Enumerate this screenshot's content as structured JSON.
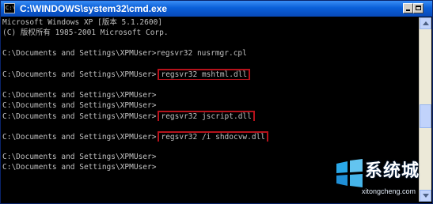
{
  "window": {
    "title": "C:\\WINDOWS\\system32\\cmd.exe",
    "icon_name": "cmd-icon",
    "icon_text": "C:\\",
    "buttons": [
      "minimize-icon",
      "maximize-icon"
    ]
  },
  "console": {
    "lines": [
      {
        "text": "Microsoft Windows XP [版本 5.1.2600]"
      },
      {
        "text": "(C) 版权所有 1985-2001 Microsoft Corp."
      },
      {
        "text": ""
      },
      {
        "text": "C:\\Documents and Settings\\XPMUser>regsvr32 nusrmgr.cpl"
      },
      {
        "text": ""
      },
      {
        "text": "C:\\Documents and Settings\\XPMUser>",
        "command": "regsvr32 mshtml.dll"
      },
      {
        "text": ""
      },
      {
        "text": "C:\\Documents and Settings\\XPMUser>"
      },
      {
        "text": "C:\\Documents and Settings\\XPMUser>"
      },
      {
        "text": "C:\\Documents and Settings\\XPMUser>",
        "command": "regsvr32 jscript.dll"
      },
      {
        "text": ""
      },
      {
        "text": "C:\\Documents and Settings\\XPMUser>",
        "command": "regsvr32 /i shdocvw.dll"
      },
      {
        "text": ""
      },
      {
        "text": "C:\\Documents and Settings\\XPMUser>"
      },
      {
        "text": "C:\\Documents and Settings\\XPMUser>"
      }
    ],
    "colors": {
      "background": "#000000",
      "text": "#c0c0c0",
      "highlight_box": "#b5121b"
    }
  },
  "watermark": {
    "name_cn": "系统城",
    "url": "xitongcheng.com"
  }
}
